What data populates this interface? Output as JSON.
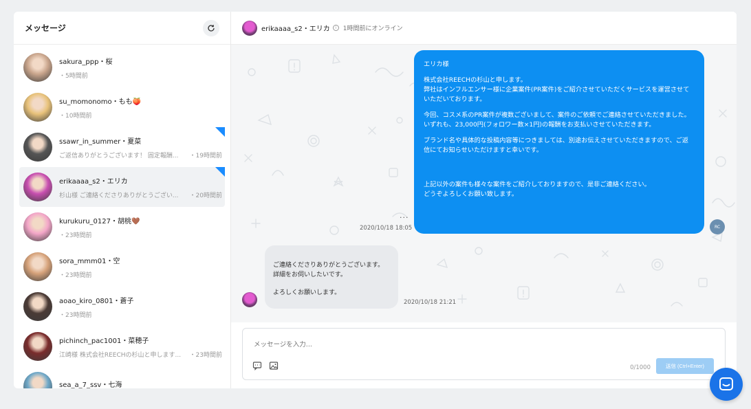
{
  "sidebar": {
    "title": "メッセージ",
    "conversations": [
      {
        "name": "sakura_ppp・桜",
        "preview": "",
        "time": "・5時間前",
        "unread": false,
        "active": false,
        "avatar_color": "#c9a58c"
      },
      {
        "name": "su_momonomo・もも🍑",
        "preview": "",
        "time": "・10時間前",
        "unread": false,
        "active": false,
        "avatar_color": "#e8c27a"
      },
      {
        "name": "ssawr_in_summer・夏菜",
        "preview": "ご返信ありがとうございます！ 固定報酬...",
        "time": "・19時間前",
        "unread": true,
        "active": false,
        "avatar_color": "#555555"
      },
      {
        "name": "erikaaaa_s2・エリカ",
        "preview": "杉山様 ご連絡くださりありがとうござい...",
        "time": "・20時間前",
        "unread": true,
        "active": true,
        "avatar_color": "#c84fb0"
      },
      {
        "name": "kurukuru_0127・胡桃🤎",
        "preview": "",
        "time": "・23時間前",
        "unread": false,
        "active": false,
        "avatar_color": "#f3a6c8"
      },
      {
        "name": "sora_mmm01・空",
        "preview": "",
        "time": "・23時間前",
        "unread": false,
        "active": false,
        "avatar_color": "#d6a27a"
      },
      {
        "name": "aoao_kiro_0801・蒼子",
        "preview": "",
        "time": "・23時間前",
        "unread": false,
        "active": false,
        "avatar_color": "#4a3a35"
      },
      {
        "name": "pichinch_pac1001・菜穂子",
        "preview": "江崎様 株式会社REECHの杉山と申します...",
        "time": "・23時間前",
        "unread": false,
        "active": false,
        "avatar_color": "#7a2c2c"
      },
      {
        "name": "sea_a_7_ssv・七海",
        "preview": "",
        "time": "",
        "unread": false,
        "active": false,
        "avatar_color": "#6fa8c8"
      }
    ]
  },
  "chat": {
    "header": {
      "name": "erikaaaa_s2・エリカ",
      "info_icon": "i",
      "status": "1時間前にオンライン"
    },
    "outgoing": {
      "paragraphs": [
        "エリカ様",
        "株式会社REECHの杉山と申します。\n弊社はインフルエンサー様に企業案件(PR案件)をご紹介させていただくサービスを運営させていただいております。",
        "今回、コスメ系のPR案件が複数ございまして、案件のご依頼でご連絡させていただきました。\nいずれも、23,000円(フォロワー数×1円)の報酬をお支払いさせていただきます。",
        "ブランド名や具体的な投稿内容等につきましては、別途お伝えさせていただきますので、ご返信にてお知らせいただけますと幸いです。",
        "上記以外の案件も様々な案件をご紹介しておりますので、是非ご連絡ください。\nどうぞよろしくお願い致します。"
      ],
      "dots": "...",
      "time": "2020/10/18 18:05",
      "avatar_label": "RC"
    },
    "incoming": {
      "lines": [
        "ご連絡くださりありがとうございます。",
        "詳細をお伺いしたいです。",
        "よろしくお願いします。"
      ],
      "time": "2020/10/18 21:21"
    },
    "composer": {
      "placeholder": "メッセージを入力...",
      "counter": "0/1000",
      "send_label": "送信 (Ctrl+Enter)"
    }
  },
  "colors": {
    "accent": "#0d8ff2",
    "unread_marker": "#1a8cff",
    "send_disabled": "#9dcdf5",
    "support": "#1a73e8"
  },
  "icons": [
    "refresh-icon",
    "info-icon",
    "template-icon",
    "image-icon",
    "chat-support-icon"
  ]
}
